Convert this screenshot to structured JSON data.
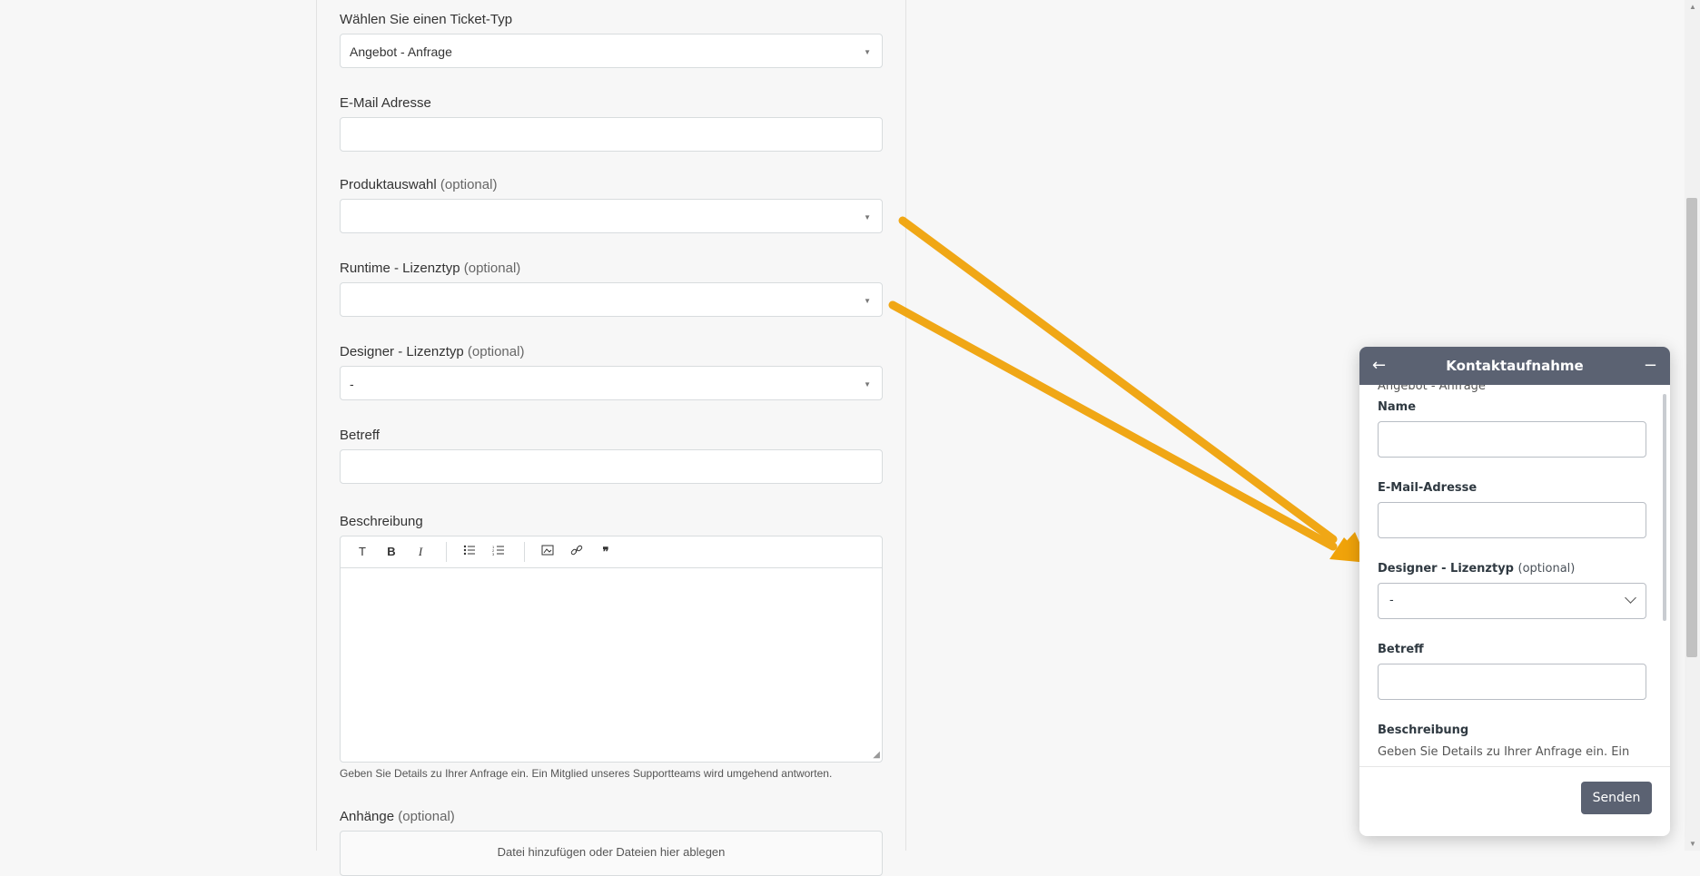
{
  "form": {
    "ticket_type": {
      "label": "Wählen Sie einen Ticket-Typ",
      "value": "Angebot - Anfrage"
    },
    "email": {
      "label": "E-Mail Adresse",
      "value": ""
    },
    "product": {
      "label": "Produktauswahl",
      "optional": "(optional)",
      "value": ""
    },
    "runtime": {
      "label": "Runtime - Lizenztyp",
      "optional": "(optional)",
      "value": ""
    },
    "designer": {
      "label": "Designer - Lizenztyp",
      "optional": "(optional)",
      "value": "-"
    },
    "subject": {
      "label": "Betreff",
      "value": ""
    },
    "description": {
      "label": "Beschreibung",
      "toolbar": [
        "T",
        "B",
        "I",
        "bulleted-list",
        "numbered-list",
        "image",
        "link",
        "quote"
      ],
      "hint": "Geben Sie Details zu Ihrer Anfrage ein. Ein Mitglied unseres Supportteams wird umgehend antworten."
    },
    "attachments": {
      "label": "Anhänge",
      "optional": "(optional)",
      "dropzone": "Datei hinzufügen oder Dateien hier ablegen"
    }
  },
  "annotation": {
    "arrow_color": "#f0a30a"
  },
  "widget": {
    "title": "Kontaktaufnahme",
    "ticket_type_value": "Angebot - Anfrage",
    "name_label": "Name",
    "email_label": "E-Mail-Adresse",
    "designer_label": "Designer - Lizenztyp",
    "designer_optional": "(optional)",
    "designer_value": "-",
    "subject_label": "Betreff",
    "description_label": "Beschreibung",
    "description_hint": "Geben Sie Details zu Ihrer Anfrage ein. Ein",
    "send_label": "Senden",
    "header_color": "#5b6272"
  }
}
